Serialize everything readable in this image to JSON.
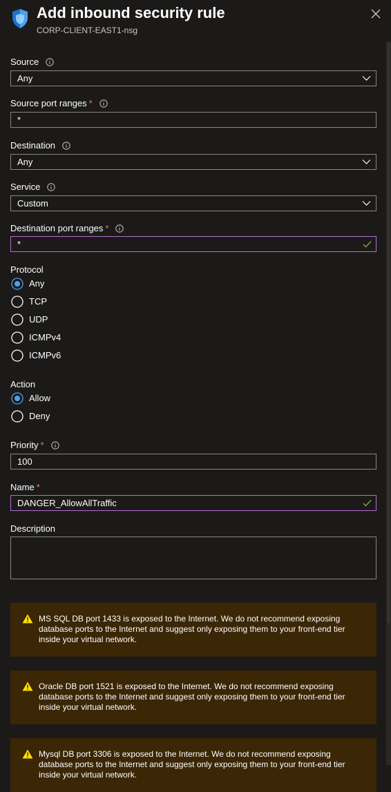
{
  "header": {
    "title": "Add inbound security rule",
    "subtitle": "CORP-CLIENT-EAST1-nsg"
  },
  "form": {
    "source": {
      "label": "Source",
      "value": "Any"
    },
    "source_port_ranges": {
      "label": "Source port ranges",
      "required_mark": "*",
      "value": "*"
    },
    "destination": {
      "label": "Destination",
      "value": "Any"
    },
    "service": {
      "label": "Service",
      "value": "Custom"
    },
    "destination_port_ranges": {
      "label": "Destination port ranges",
      "required_mark": "*",
      "value": "*"
    },
    "protocol": {
      "label": "Protocol",
      "options": [
        "Any",
        "TCP",
        "UDP",
        "ICMPv4",
        "ICMPv6"
      ],
      "selected": "Any"
    },
    "action": {
      "label": "Action",
      "options": [
        "Allow",
        "Deny"
      ],
      "selected": "Allow"
    },
    "priority": {
      "label": "Priority",
      "required_mark": "*",
      "value": "100"
    },
    "name": {
      "label": "Name",
      "required_mark": "*",
      "value": "DANGER_AllowAllTraffic"
    },
    "description": {
      "label": "Description",
      "value": ""
    }
  },
  "warnings": [
    {
      "text": "MS SQL DB port 1433 is exposed to the Internet. We do not recommend exposing database ports to the Internet and suggest only exposing them to your front-end tier inside your virtual network."
    },
    {
      "text": "Oracle DB port 1521 is exposed to the Internet. We do not recommend exposing database ports to the Internet and suggest only exposing them to your front-end tier inside your virtual network."
    },
    {
      "text": "Mysql DB port 3306 is exposed to the Internet. We do not recommend exposing database ports to the Internet and suggest only exposing them to your front-end tier inside your virtual network."
    }
  ],
  "colors": {
    "background": "#1b1a19",
    "accent_radio": "#4f9ef2",
    "valid_border": "#b36fd1",
    "valid_check": "#92c353",
    "required": "#f1707b",
    "warning_bg": "#3b2605",
    "warning_icon": "#fce100"
  },
  "icons": {
    "header": "shield-icon",
    "close": "close-icon",
    "info": "info-icon",
    "dropdown": "chevron-down-icon",
    "valid": "checkmark-icon",
    "warning": "warning-icon"
  }
}
